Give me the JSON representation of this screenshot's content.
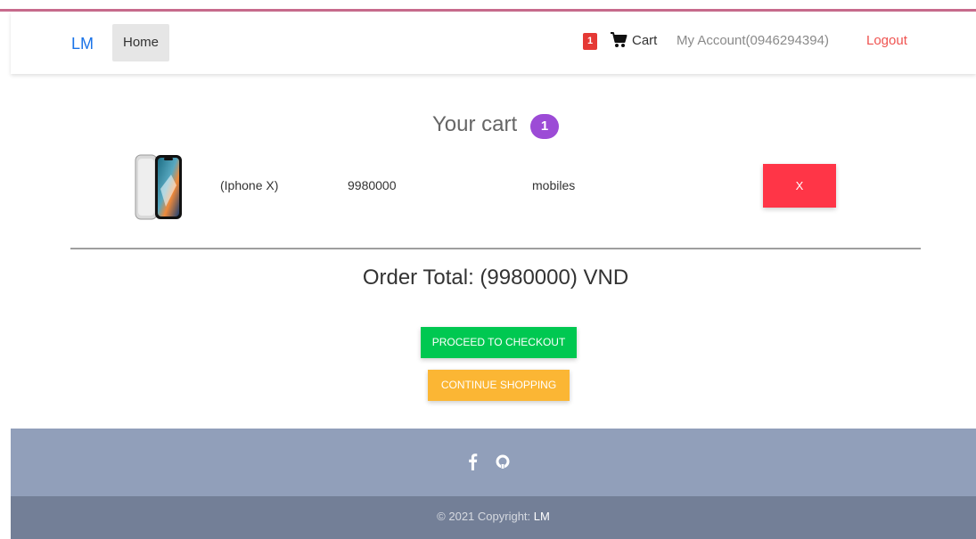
{
  "nav": {
    "brand": "LM",
    "home": "Home",
    "cart_badge": "1",
    "cart_label": "Cart",
    "account": "My Account(0946294394)",
    "logout": "Logout"
  },
  "cart": {
    "title": "Your cart",
    "count": "1",
    "items": [
      {
        "name": "(Iphone X)",
        "price": "9980000",
        "category": "mobiles",
        "remove_label": "X"
      }
    ],
    "order_total": "Order Total: (9980000) VND",
    "checkout_label": "PROCEED TO CHECKOUT",
    "continue_label": "CONTINUE SHOPPING"
  },
  "footer": {
    "copyright_prefix": "© 2021 Copyright: ",
    "copyright_brand": "LM",
    "icons": [
      "facebook-icon",
      "github-icon"
    ]
  },
  "colors": {
    "accent": "#1a73e8",
    "danger": "#ff3547",
    "success": "#00c851",
    "warning": "#fbb634",
    "badge": "#9c4bd6",
    "footer_top": "#919fba",
    "footer_bottom": "#737f97"
  }
}
